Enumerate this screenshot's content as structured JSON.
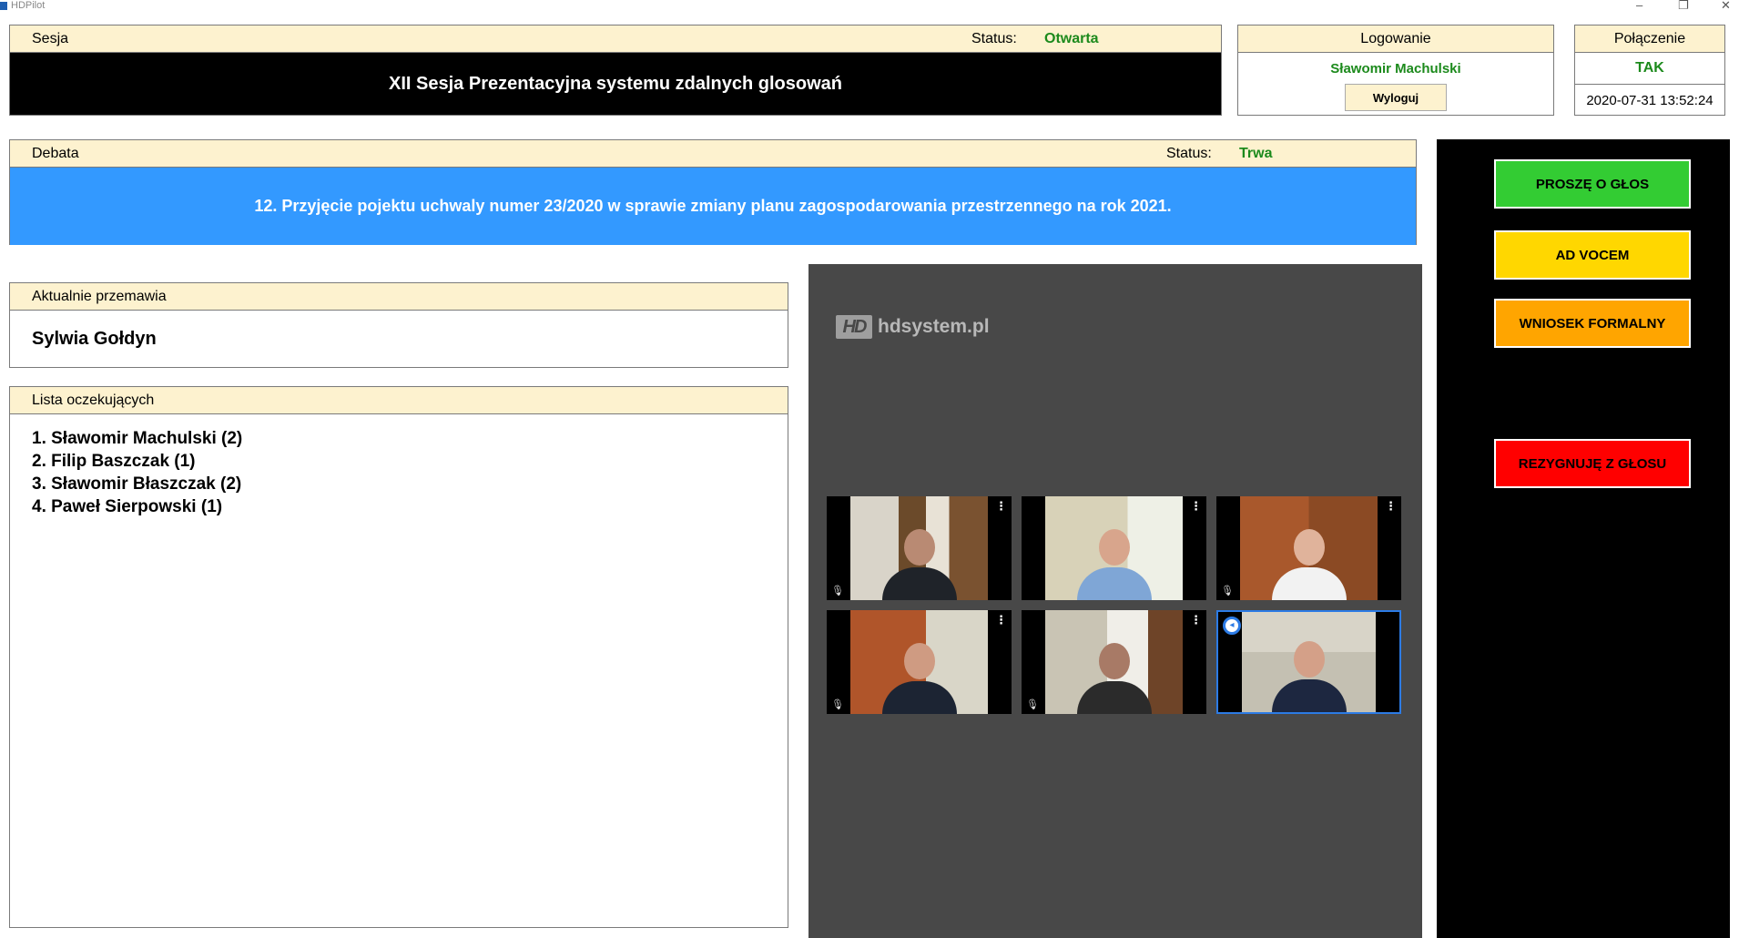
{
  "window": {
    "title": "HDPilot",
    "minimize": "–",
    "maximize": "❐",
    "close": "✕"
  },
  "session": {
    "header": "Sesja",
    "status_label": "Status:",
    "status_value": "Otwarta",
    "title": "XII Sesja Prezentacyjna systemu zdalnych glosowań"
  },
  "login": {
    "header": "Logowanie",
    "user": "Sławomir Machulski",
    "logout_label": "Wyloguj"
  },
  "connection": {
    "header": "Połączenie",
    "value": "TAK",
    "timestamp": "2020-07-31 13:52:24"
  },
  "debate": {
    "header": "Debata",
    "status_label": "Status:",
    "status_value": "Trwa",
    "topic": "12. Przyjęcie pojektu uchwaly numer 23/2020 w sprawie zmiany planu zagospodarowania przestrzennego na rok 2021."
  },
  "current_speaker": {
    "header": "Aktualnie przemawia",
    "name": "Sylwia Gołdyn"
  },
  "waiting_list": {
    "header": "Lista oczekujących",
    "items": [
      "1. Sławomir Machulski (2)",
      "2. Filip Baszczak (1)",
      "3. Sławomir Błaszczak (2)",
      "4. Paweł Sierpowski (1)"
    ]
  },
  "video": {
    "logo_mark": "HD",
    "logo_text": "hdsystem.pl",
    "tiles": [
      {
        "icon": "office-bookshelf-scene",
        "muted": true,
        "active": false
      },
      {
        "icon": "office-window-scene",
        "muted": false,
        "active": false
      },
      {
        "icon": "office-door-scene",
        "muted": true,
        "active": false
      },
      {
        "icon": "office-wall-scene",
        "muted": true,
        "active": false
      },
      {
        "icon": "office-shelf-scene",
        "muted": true,
        "active": false
      },
      {
        "icon": "office-room-scene",
        "muted": false,
        "active": true
      }
    ],
    "menu_glyph": "⋮",
    "mic_glyph": "🎙"
  },
  "controls": {
    "request_floor": "PROSZĘ O GŁOS",
    "ad_vocem": "AD VOCEM",
    "formal_motion": "WNIOSEK FORMALNY",
    "resign_floor": "REZYGNUJĘ Z GŁOSU"
  },
  "colors": {
    "panel_header": "#fdf2cf",
    "status_green": "#1c8a1c",
    "debate_blue": "#3399ff",
    "request_green": "#33cc33",
    "ad_vocem_yellow": "#ffd700",
    "formal_orange": "#ffa500",
    "resign_red": "#ff0000"
  }
}
